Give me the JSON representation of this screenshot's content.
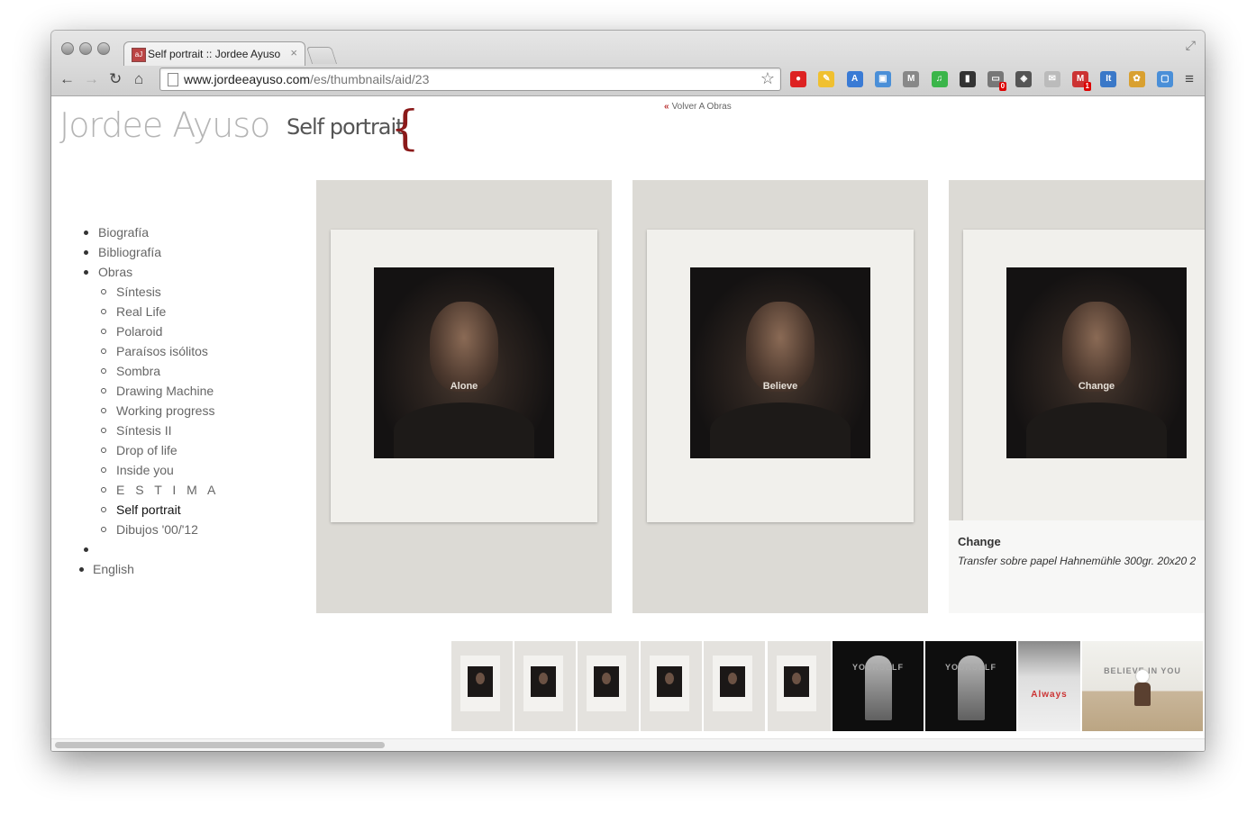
{
  "browser": {
    "tab_title": "Self portrait :: Jordee Ayuso",
    "tab_close": "×",
    "tab_favicon": "aJ",
    "url_host": "www.jordeeayuso.com",
    "url_path": "/es/thumbnails/aid/23",
    "nav": {
      "back": "←",
      "forward": "→",
      "reload": "↻",
      "home": "⌂",
      "star": "☆",
      "menu": "≡",
      "fullscreen": "⤢"
    },
    "extensions": [
      {
        "name": "stop-icon",
        "color": "#d22",
        "glyph": "●",
        "badge": ""
      },
      {
        "name": "note-icon",
        "color": "#f0c030",
        "glyph": "✎",
        "badge": ""
      },
      {
        "name": "translate-icon",
        "color": "#3a7bd5",
        "glyph": "A",
        "badge": ""
      },
      {
        "name": "screen-icon",
        "color": "#4a8fd8",
        "glyph": "▣",
        "badge": ""
      },
      {
        "name": "mail-icon",
        "color": "#888",
        "glyph": "M",
        "badge": ""
      },
      {
        "name": "spotify-icon",
        "color": "#3bb54a",
        "glyph": "♫",
        "badge": ""
      },
      {
        "name": "phone-icon",
        "color": "#333",
        "glyph": "▮",
        "badge": ""
      },
      {
        "name": "bar-icon",
        "color": "#777",
        "glyph": "▭",
        "badge": "0"
      },
      {
        "name": "evernote-icon",
        "color": "#555",
        "glyph": "◈",
        "badge": ""
      },
      {
        "name": "gmail-grey-icon",
        "color": "#bbb",
        "glyph": "✉",
        "badge": ""
      },
      {
        "name": "gmail-icon",
        "color": "#c33",
        "glyph": "M",
        "badge": "1"
      },
      {
        "name": "it-icon",
        "color": "#3a78c8",
        "glyph": "It",
        "badge": ""
      },
      {
        "name": "basket-icon",
        "color": "#d9a030",
        "glyph": "✿",
        "badge": ""
      },
      {
        "name": "window-icon",
        "color": "#4a8fd8",
        "glyph": "▢",
        "badge": ""
      }
    ]
  },
  "site": {
    "title": "Jordee Ayuso",
    "section_title": "Self portrait",
    "brace": "{",
    "back_chevron": "«",
    "back_link": "Volver A Obras"
  },
  "nav": {
    "items": [
      {
        "label": "Biografía",
        "level": 1
      },
      {
        "label": "Bibliografía",
        "level": 1
      },
      {
        "label": "Obras",
        "level": 1
      },
      {
        "label": "Síntesis",
        "level": 2
      },
      {
        "label": "Real Life",
        "level": 2
      },
      {
        "label": "Polaroid",
        "level": 2
      },
      {
        "label": "Paraísos isólitos",
        "level": 2
      },
      {
        "label": "Sombra",
        "level": 2
      },
      {
        "label": "Drawing Machine",
        "level": 2
      },
      {
        "label": "Working progress",
        "level": 2
      },
      {
        "label": "Síntesis II",
        "level": 2
      },
      {
        "label": "Drop of life",
        "level": 2
      },
      {
        "label": "Inside you",
        "level": 2
      },
      {
        "label": "E S T I M A",
        "level": 2
      },
      {
        "label": "Self portrait",
        "level": 2,
        "active": true
      },
      {
        "label": "Dibujos '00/'12",
        "level": 2
      },
      {
        "label": "",
        "level": 1
      },
      {
        "label": "English",
        "level": 1
      }
    ]
  },
  "gallery": {
    "panels": [
      {
        "label": "Alone"
      },
      {
        "label": "Believe"
      },
      {
        "label": "Change",
        "caption_title": "Change",
        "caption_desc": "Transfer sobre papel Hahnemühle 300gr. 20x20 2"
      }
    ],
    "thumbs": [
      {
        "kind": "polaroid",
        "label": ""
      },
      {
        "kind": "polaroid",
        "label": ""
      },
      {
        "kind": "polaroid",
        "label": ""
      },
      {
        "kind": "polaroid",
        "label": ""
      },
      {
        "kind": "polaroid",
        "label": ""
      },
      {
        "kind": "polaroid",
        "label": ""
      },
      {
        "kind": "dark",
        "label": "YOURSELF"
      },
      {
        "kind": "dark",
        "label": "YOURSELF"
      },
      {
        "kind": "white",
        "label": "Always"
      },
      {
        "kind": "beach",
        "label": "BELIEVE IN YOU"
      }
    ]
  }
}
